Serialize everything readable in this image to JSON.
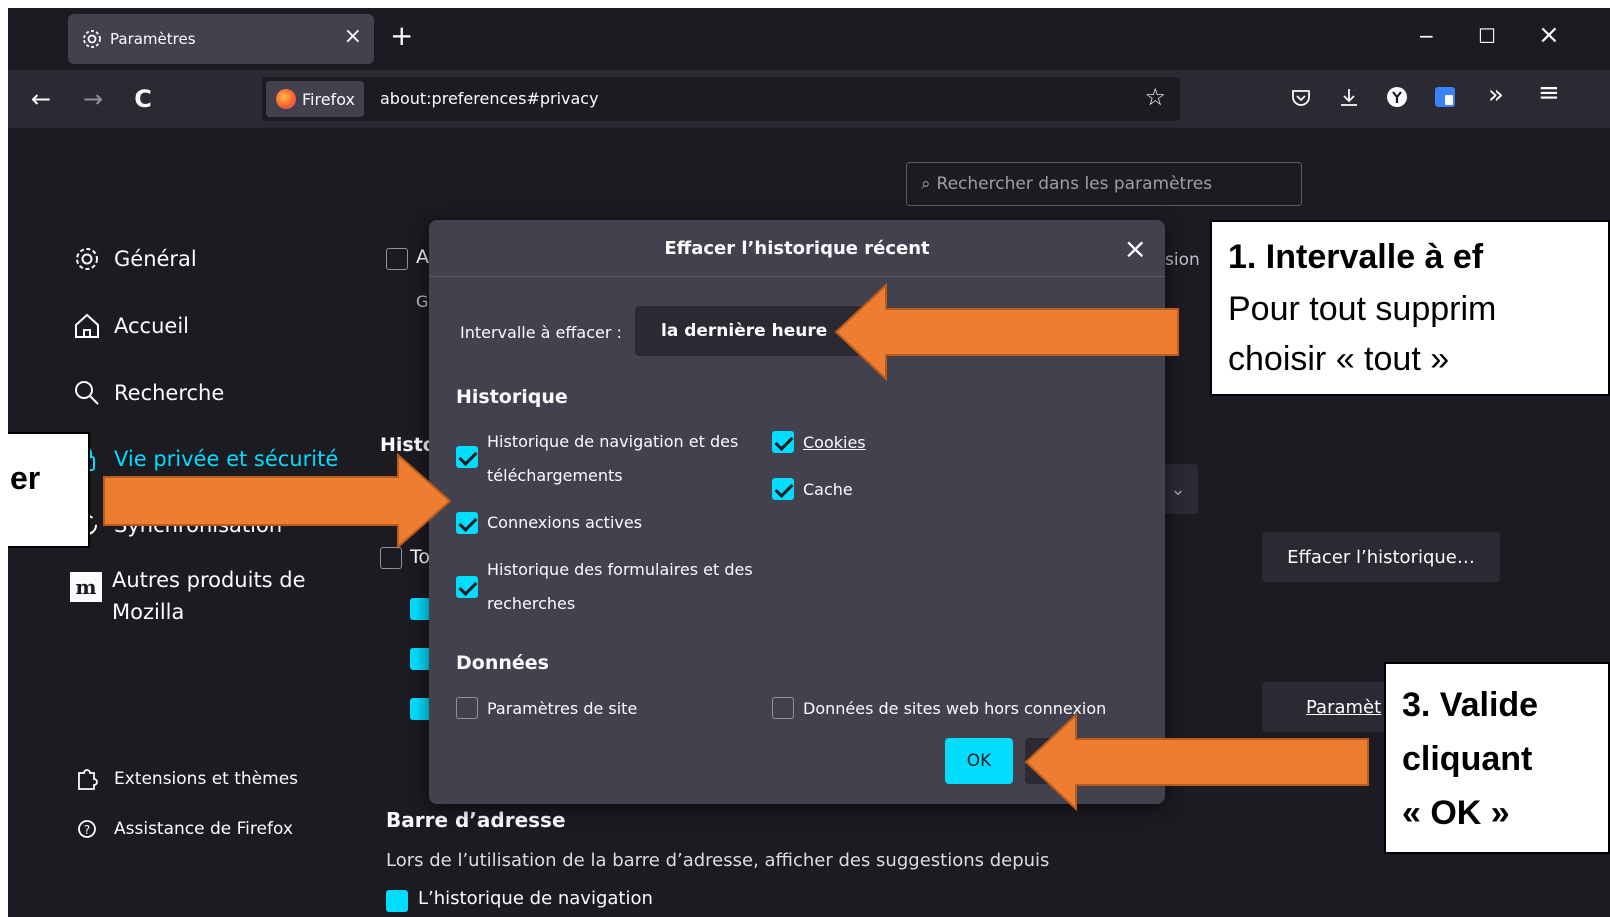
{
  "tab": {
    "title": "Paramètres",
    "close": "×"
  },
  "newtab": "+",
  "window": {
    "minimize": "−",
    "maximize": "☐",
    "close": "×"
  },
  "nav": {
    "back": "←",
    "forward": "→",
    "reload": "C"
  },
  "url": {
    "identity": "Firefox",
    "address": "about:preferences#privacy",
    "bookmark": "☆"
  },
  "toolbar": {
    "overflow": "»",
    "menu": "≡"
  },
  "search": {
    "placeholder": "Rechercher dans les paramètres"
  },
  "sidebar": {
    "items": [
      {
        "label": "Général"
      },
      {
        "label": "Accueil"
      },
      {
        "label": "Recherche"
      },
      {
        "label": "Vie privée et sécurité"
      },
      {
        "label": "Synchronisation"
      },
      {
        "label": "Autres produits de"
      },
      {
        "label2": "Mozilla"
      }
    ],
    "extensions": "Extensions et thèmes",
    "support": "Assistance de Firefox"
  },
  "background": {
    "a_letter": "A",
    "g_letter": "G",
    "sion": "sion",
    "histo": "Histo",
    "to": "To",
    "clear_history_button": "Effacer l’historique…",
    "settings_button": "Paramèt",
    "address_bar_heading": "Barre d’adresse",
    "address_bar_desc": "Lors de l’utilisation de la barre d’adresse, afficher des suggestions depuis",
    "nav_history_item": "L’historique de navigation"
  },
  "dialog": {
    "title": "Effacer l’historique récent",
    "close": "×",
    "range_label": "Intervalle à effacer :",
    "range_value": "la dernière heure",
    "history_heading": "Historique",
    "nav_history_line1": "Historique de navigation et des",
    "nav_history_line2": "téléchargements",
    "cookies": "Cookies",
    "cache": "Cache",
    "active_connections": "Connexions actives",
    "forms_line1": "Historique des formulaires et des",
    "forms_line2": "recherches",
    "data_heading": "Données",
    "site_settings": "Paramètres de site",
    "offline_data": "Données de sites web hors connexion",
    "ok": "OK"
  },
  "callouts": {
    "c1_title": "1.   Intervalle à ef",
    "c1_line1": "Pour tout supprim",
    "c1_line2": "choisir « tout »",
    "c2_fragment": "er",
    "c3_line1": "3. Valide",
    "c3_line2": "cliquant",
    "c3_line3": "« OK »"
  },
  "colors": {
    "accent": "#00ddff",
    "arrow": "#ed7d31",
    "bg": "#1c1b22",
    "dialog": "#42414d"
  }
}
